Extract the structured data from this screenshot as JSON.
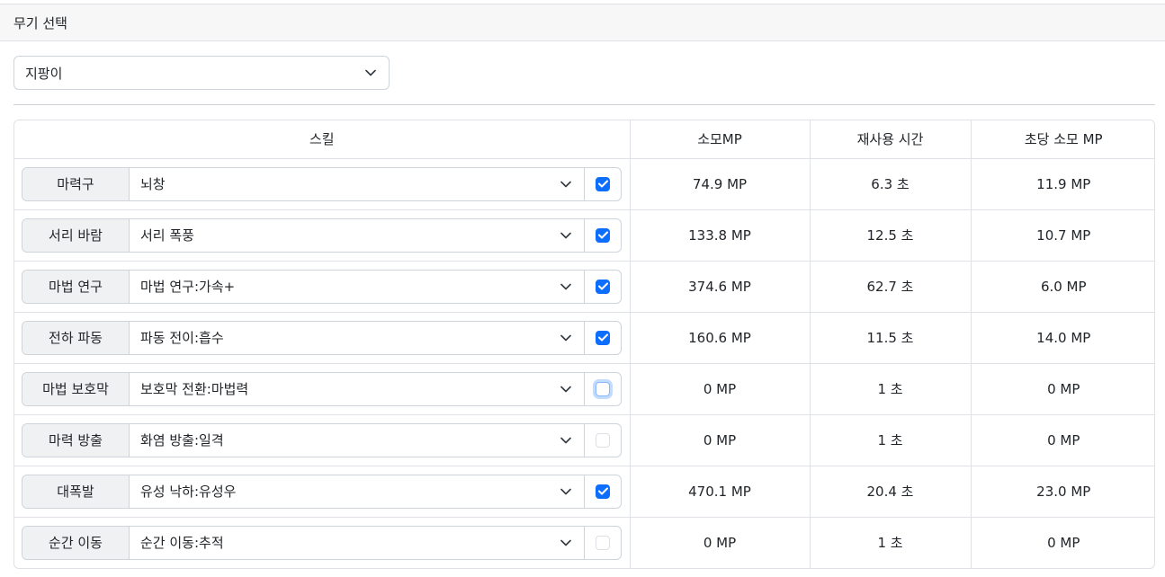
{
  "header": {
    "title": "무기 선택"
  },
  "weapon": {
    "selected": "지팡이"
  },
  "table": {
    "columns": [
      "스킬",
      "소모MP",
      "재사용 시간",
      "초당 소모 MP"
    ],
    "rows": [
      {
        "category": "마력구",
        "skill": "뇌창",
        "state": "checked",
        "mp": "74.9 MP",
        "cooldown": "6.3 초",
        "mps": "11.9 MP"
      },
      {
        "category": "서리 바람",
        "skill": "서리 폭풍",
        "state": "checked",
        "mp": "133.8 MP",
        "cooldown": "12.5 초",
        "mps": "10.7 MP"
      },
      {
        "category": "마법 연구",
        "skill": "마법 연구:가속+",
        "state": "checked",
        "mp": "374.6 MP",
        "cooldown": "62.7 초",
        "mps": "6.0 MP"
      },
      {
        "category": "전하 파동",
        "skill": "파동 전이:흡수",
        "state": "checked",
        "mp": "160.6 MP",
        "cooldown": "11.5 초",
        "mps": "14.0 MP"
      },
      {
        "category": "마법 보호막",
        "skill": "보호막 전환:마법력",
        "state": "focused",
        "mp": "0 MP",
        "cooldown": "1 초",
        "mps": "0 MP"
      },
      {
        "category": "마력 방출",
        "skill": "화염 방출:일격",
        "state": "disabled",
        "mp": "0 MP",
        "cooldown": "1 초",
        "mps": "0 MP"
      },
      {
        "category": "대폭발",
        "skill": "유성 낙하:유성우",
        "state": "checked",
        "mp": "470.1 MP",
        "cooldown": "20.4 초",
        "mps": "23.0 MP"
      },
      {
        "category": "순간 이동",
        "skill": "순간 이동:추적",
        "state": "disabled",
        "mp": "0 MP",
        "cooldown": "1 초",
        "mps": "0 MP"
      }
    ]
  },
  "colors": {
    "accent": "#0d6efd",
    "border": "#dee2e6",
    "header_bg": "#f7f7f7",
    "label_bg": "#f0f1f3"
  },
  "icons": {
    "dropdown": "chevron-down-icon",
    "check": "check-icon"
  }
}
